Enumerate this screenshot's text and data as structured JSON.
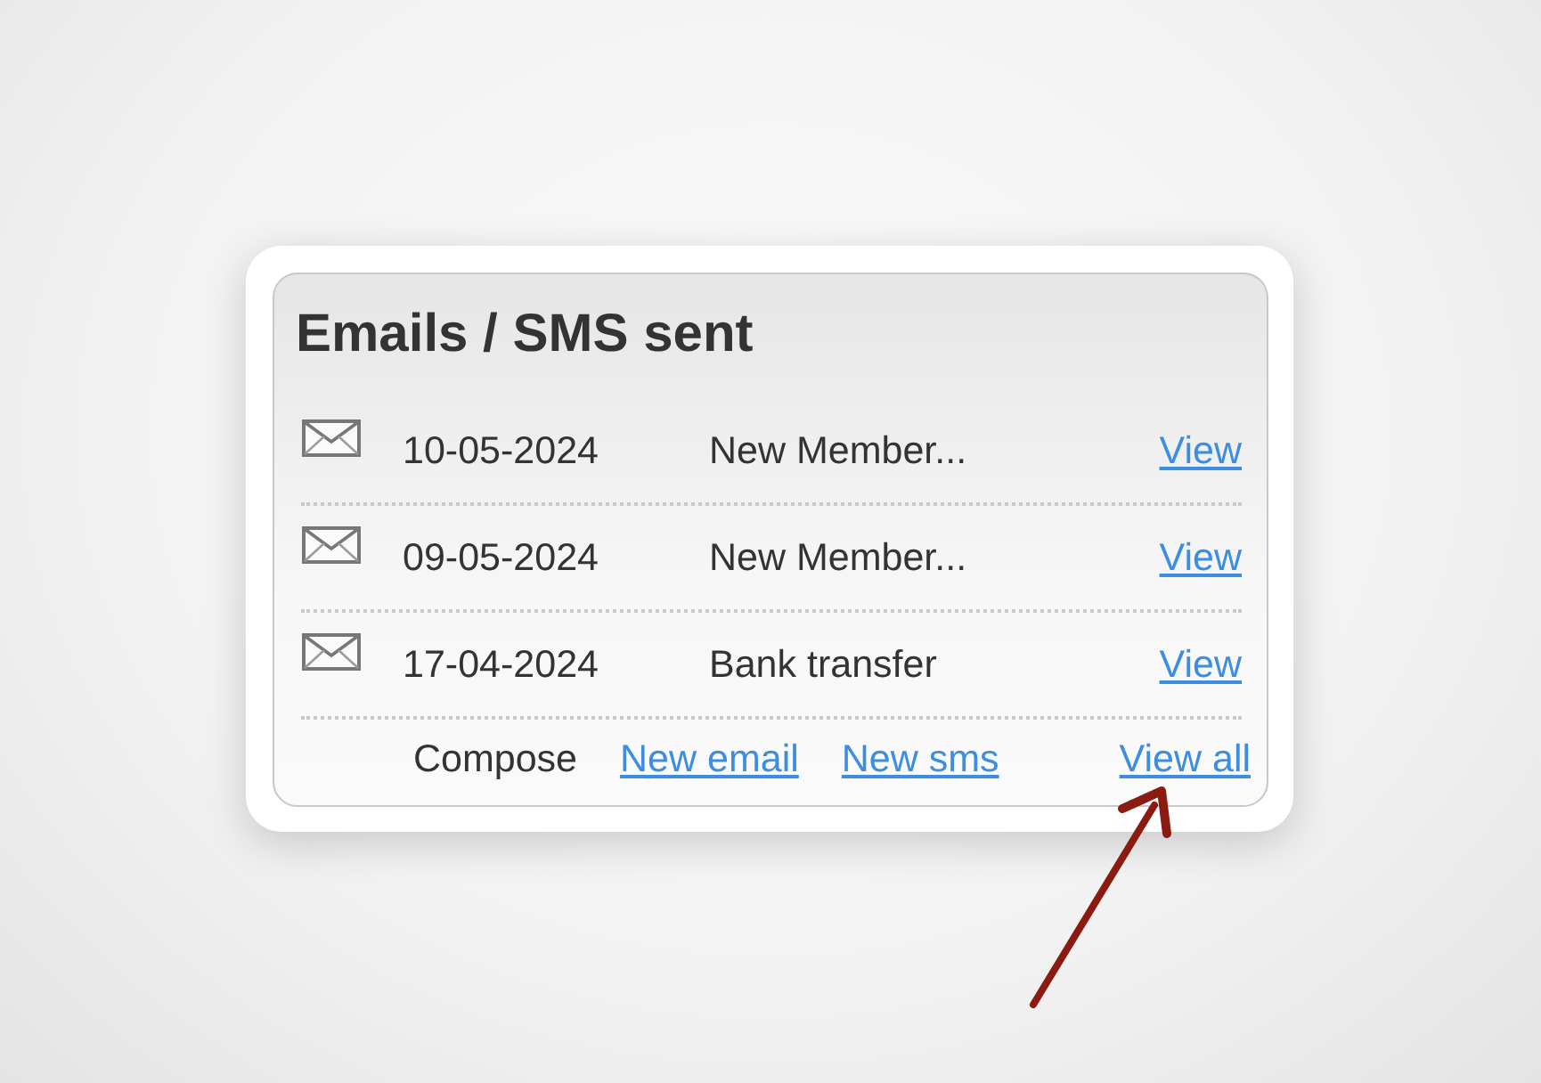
{
  "panel": {
    "title": "Emails / SMS sent"
  },
  "messages": [
    {
      "date": "10-05-2024",
      "subject": "New Member...",
      "action": "View"
    },
    {
      "date": "09-05-2024",
      "subject": "New Member...",
      "action": "View"
    },
    {
      "date": "17-04-2024",
      "subject": "Bank transfer",
      "action": "View"
    }
  ],
  "footer": {
    "label": "Compose",
    "links": [
      "New email",
      "New sms"
    ],
    "view_all": "View all"
  }
}
